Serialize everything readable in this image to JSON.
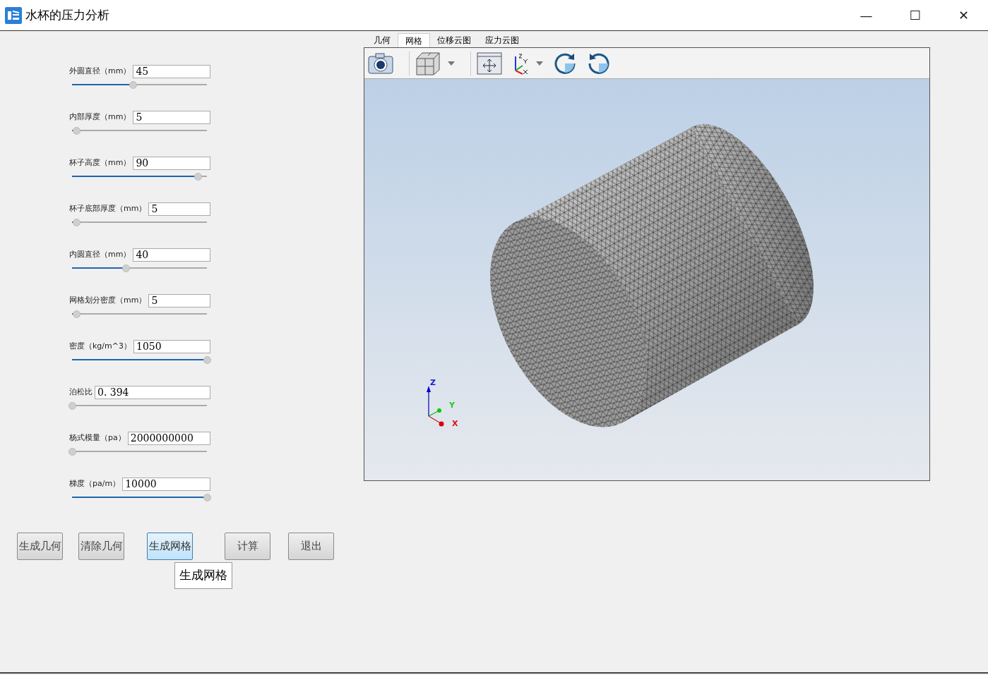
{
  "window": {
    "title": "水杯的压力分析",
    "controls": [
      "—",
      "☐",
      "✕"
    ]
  },
  "parameters": [
    {
      "label": "外圆直径（mm）",
      "value": "45",
      "level": 0.45
    },
    {
      "label": "内部厚度（mm）",
      "value": "5",
      "level": 0.03
    },
    {
      "label": "杯子高度（mm）",
      "value": "90",
      "level": 0.93
    },
    {
      "label": "杯子底部厚度（mm）",
      "value": "5",
      "level": 0.03
    },
    {
      "label": "内圆直径（mm）",
      "value": "40",
      "level": 0.4
    },
    {
      "label": "网格划分密度（mm）",
      "value": "5",
      "level": 0.03
    },
    {
      "label": "密度（kg/m^3）",
      "value": "1050",
      "level": 1
    },
    {
      "label": "泊松比",
      "value": "0. 394",
      "level": 0
    },
    {
      "label": "杨式模量（pa）",
      "value": "2000000000",
      "level": 0
    },
    {
      "label": "梯度（pa/m）",
      "value": "10000",
      "level": 1
    }
  ],
  "buttons": [
    {
      "label": "生成几何",
      "selected": false
    },
    {
      "label": "清除几何",
      "selected": false
    },
    {
      "label": "生成网格",
      "selected": true
    },
    {
      "label": "计算",
      "selected": false
    },
    {
      "label": "退出",
      "selected": false
    }
  ],
  "tooltip": "生成网格",
  "tabs": [
    {
      "label": "几何",
      "selected": false
    },
    {
      "label": "网格",
      "selected": true
    },
    {
      "label": "位移云图",
      "selected": false
    },
    {
      "label": "应力云图",
      "selected": false
    }
  ],
  "toolbar": [
    {
      "kind": "camera"
    },
    {
      "kind": "cube",
      "dropdown": true
    },
    {
      "kind": "fit"
    },
    {
      "kind": "axes",
      "dropdown": true
    },
    {
      "kind": "rotate-cw"
    },
    {
      "kind": "rotate-ccw"
    }
  ],
  "triad_labels": [
    "Z",
    "Y",
    "X"
  ]
}
